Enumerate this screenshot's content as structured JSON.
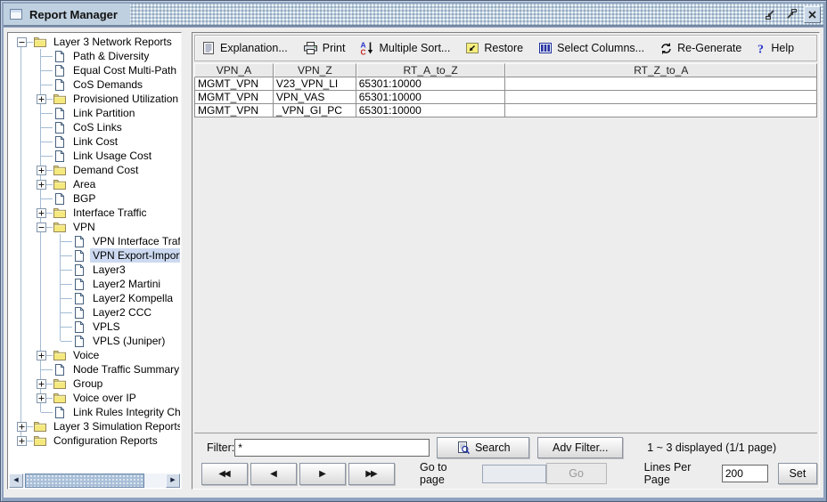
{
  "window": {
    "title": "Report Manager"
  },
  "colors": {
    "selection": "#ccd9f0",
    "titlebar": "#bfd0e0",
    "frame": "#8fa3bf",
    "folder_yellow": "#f5e97e",
    "accent_blue": "#2735c9"
  },
  "tree": {
    "items": [
      {
        "label": "Layer 3 Network Reports",
        "depth": 0,
        "kind": "folder",
        "toggle": "minus",
        "selected": false
      },
      {
        "label": "Path & Diversity",
        "depth": 1,
        "kind": "doc",
        "toggle": null,
        "selected": false
      },
      {
        "label": "Equal Cost Multi-Path",
        "depth": 1,
        "kind": "doc",
        "toggle": null,
        "selected": false
      },
      {
        "label": "CoS Demands",
        "depth": 1,
        "kind": "doc",
        "toggle": null,
        "selected": false
      },
      {
        "label": "Provisioned Utilization",
        "depth": 1,
        "kind": "folder",
        "toggle": "plus",
        "selected": false
      },
      {
        "label": "Link Partition",
        "depth": 1,
        "kind": "doc",
        "toggle": null,
        "selected": false
      },
      {
        "label": "CoS Links",
        "depth": 1,
        "kind": "doc",
        "toggle": null,
        "selected": false
      },
      {
        "label": "Link Cost",
        "depth": 1,
        "kind": "doc",
        "toggle": null,
        "selected": false
      },
      {
        "label": "Link Usage Cost",
        "depth": 1,
        "kind": "doc",
        "toggle": null,
        "selected": false
      },
      {
        "label": "Demand Cost",
        "depth": 1,
        "kind": "folder",
        "toggle": "plus",
        "selected": false
      },
      {
        "label": "Area",
        "depth": 1,
        "kind": "folder",
        "toggle": "plus",
        "selected": false
      },
      {
        "label": "BGP",
        "depth": 1,
        "kind": "doc",
        "toggle": null,
        "selected": false
      },
      {
        "label": "Interface Traffic",
        "depth": 1,
        "kind": "folder",
        "toggle": "plus",
        "selected": false
      },
      {
        "label": "VPN",
        "depth": 1,
        "kind": "folder",
        "toggle": "minus",
        "selected": false
      },
      {
        "label": "VPN Interface Traffic",
        "depth": 2,
        "kind": "doc",
        "toggle": null,
        "selected": false
      },
      {
        "label": "VPN Export-Import",
        "depth": 2,
        "kind": "doc",
        "toggle": null,
        "selected": true
      },
      {
        "label": "Layer3",
        "depth": 2,
        "kind": "doc",
        "toggle": null,
        "selected": false
      },
      {
        "label": "Layer2 Martini",
        "depth": 2,
        "kind": "doc",
        "toggle": null,
        "selected": false
      },
      {
        "label": "Layer2 Kompella",
        "depth": 2,
        "kind": "doc",
        "toggle": null,
        "selected": false
      },
      {
        "label": "Layer2 CCC",
        "depth": 2,
        "kind": "doc",
        "toggle": null,
        "selected": false
      },
      {
        "label": "VPLS",
        "depth": 2,
        "kind": "doc",
        "toggle": null,
        "selected": false
      },
      {
        "label": "VPLS (Juniper)",
        "depth": 2,
        "kind": "doc",
        "toggle": null,
        "selected": false
      },
      {
        "label": "Voice",
        "depth": 1,
        "kind": "folder",
        "toggle": "plus",
        "selected": false
      },
      {
        "label": "Node Traffic Summary",
        "depth": 1,
        "kind": "doc",
        "toggle": null,
        "selected": false
      },
      {
        "label": "Group",
        "depth": 1,
        "kind": "folder",
        "toggle": "plus",
        "selected": false
      },
      {
        "label": "Voice over IP",
        "depth": 1,
        "kind": "folder",
        "toggle": "plus",
        "selected": false
      },
      {
        "label": "Link Rules Integrity Check",
        "depth": 1,
        "kind": "doc",
        "toggle": null,
        "selected": false
      },
      {
        "label": "Layer 3 Simulation Reports",
        "depth": 0,
        "kind": "folder",
        "toggle": "plus",
        "selected": false
      },
      {
        "label": "Configuration Reports",
        "depth": 0,
        "kind": "folder",
        "toggle": "plus",
        "selected": false
      }
    ]
  },
  "toolbar": {
    "items": [
      {
        "label": "Explanation...",
        "icon": "explanation-icon"
      },
      {
        "label": "Print",
        "icon": "print-icon"
      },
      {
        "label": "Multiple Sort...",
        "icon": "multiple-sort-icon"
      },
      {
        "label": "Restore",
        "icon": "restore-icon"
      },
      {
        "label": "Select Columns...",
        "icon": "select-columns-icon"
      },
      {
        "label": "Re-Generate",
        "icon": "regenerate-icon"
      },
      {
        "label": "Help",
        "icon": "help-icon"
      }
    ]
  },
  "table": {
    "columns": [
      "VPN_A",
      "VPN_Z",
      "RT_A_to_Z",
      "RT_Z_to_A"
    ],
    "rows": [
      [
        "MGMT_VPN",
        "V23_VPN_LI",
        "65301:10000",
        ""
      ],
      [
        "MGMT_VPN",
        "VPN_VAS",
        "65301:10000",
        ""
      ],
      [
        "MGMT_VPN",
        "_VPN_GI_PC",
        "65301:10000",
        ""
      ]
    ]
  },
  "filter": {
    "label": "Filter:",
    "value": "*",
    "search_label": "Search",
    "adv_filter_label": "Adv Filter...",
    "status": "1 ~ 3 displayed (1/1 page)"
  },
  "pagination": {
    "nav": [
      {
        "name": "first",
        "glyph": "◀◀"
      },
      {
        "name": "prev",
        "glyph": "◀"
      },
      {
        "name": "next",
        "glyph": "▶"
      },
      {
        "name": "last",
        "glyph": "▶▶"
      }
    ],
    "goto_label": "Go to page",
    "goto_value": "",
    "go_label": "Go",
    "lines_label": "Lines Per Page",
    "lines_value": "200",
    "set_label": "Set"
  }
}
